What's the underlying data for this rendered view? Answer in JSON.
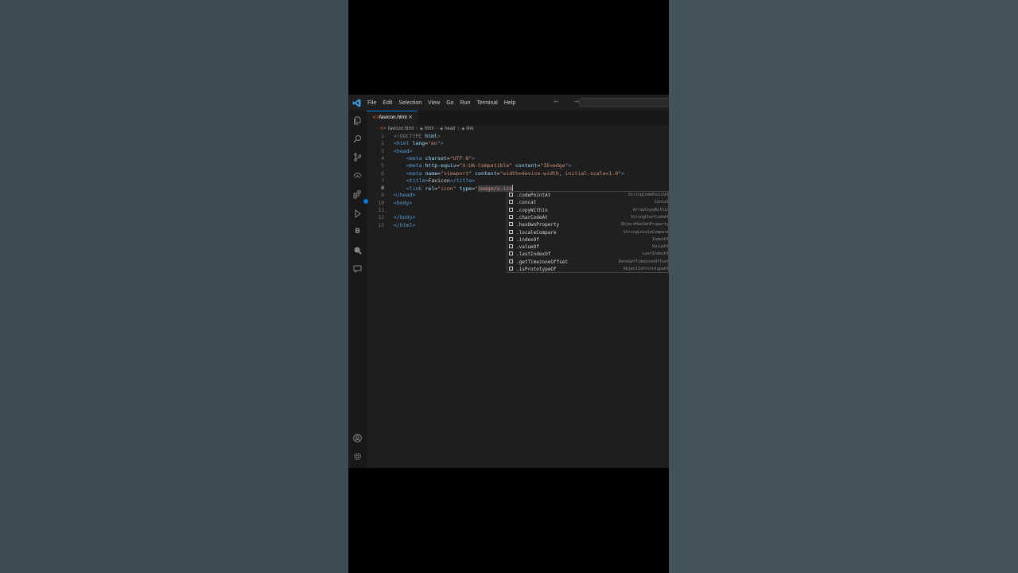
{
  "menu": [
    "File",
    "Edit",
    "Selection",
    "View",
    "Go",
    "Run",
    "Terminal",
    "Help"
  ],
  "nav_arrows": "← →",
  "activity_icons": [
    "explorer-icon",
    "search-icon",
    "source-control-icon",
    "remote-explorer-icon",
    "extensions-icon",
    "run-debug-icon",
    "bookmark-b-icon",
    "settings-sync-icon",
    "chat-icon",
    "account-icon",
    "manage-gear-icon"
  ],
  "tab": {
    "label": "favicon.html",
    "close": "×"
  },
  "breadcrumb": {
    "file": "favicon.html",
    "items": [
      "html",
      "head",
      "link"
    ]
  },
  "code_lines": [
    {
      "n": "1"
    },
    {
      "n": "2"
    },
    {
      "n": "3"
    },
    {
      "n": "4"
    },
    {
      "n": "5"
    },
    {
      "n": "6"
    },
    {
      "n": "7"
    },
    {
      "n": "8"
    },
    {
      "n": "9"
    },
    {
      "n": "10"
    },
    {
      "n": "11"
    },
    {
      "n": "12"
    },
    {
      "n": "13"
    }
  ],
  "code": {
    "l1_doctype": "<!DOCTYPE",
    "l1_html": " html",
    "l1_end": ">",
    "l2_open": "<html",
    "l2_attr": " lang",
    "l2_val": "\"en\"",
    "l3": "<head>",
    "l4_tag": "<meta",
    "l4_attr": " charset",
    "l4_val": "\"UTF-8\"",
    "l5_tag": "<meta",
    "l5_attr1": " http-equiv",
    "l5_val1": "\"X-UA-Compatible\"",
    "l5_attr2": " content",
    "l5_val2": "\"IE=edge\"",
    "l6_tag": "<meta",
    "l6_attr1": " name",
    "l6_val1": "\"viewport\"",
    "l6_attr2": " content",
    "l6_val2": "\"width=device-width, initial-scale=1.0\"",
    "l7_open": "<title>",
    "l7_text": "Favicon",
    "l7_close": "</title>",
    "l8_tag": "<link",
    "l8_attr1": " rel",
    "l8_val1": "\"icon\"",
    "l8_attr2": " type",
    "l8_quote": "\"",
    "l8_sel": "image/x-ico",
    "l9": "</head>",
    "l10": "<body>",
    "l12": "</body>",
    "l13": "</html>"
  },
  "suggestions": [
    {
      "label": ".codePointAt",
      "detail": "StringCodePointAt"
    },
    {
      "label": ".concat",
      "detail": "Concat"
    },
    {
      "label": ".copyWithin",
      "detail": "ArrayCopyWithin"
    },
    {
      "label": ".charCodeAt",
      "detail": "StringCharCodeAt"
    },
    {
      "label": ".hasOwnProperty",
      "detail": "ObjectHasOwnProperty"
    },
    {
      "label": ".localeCompare",
      "detail": "StringLocaleCompare"
    },
    {
      "label": ".indexOf",
      "detail": "IndexOf"
    },
    {
      "label": ".valueOf",
      "detail": "ValueOf"
    },
    {
      "label": ".lastIndexOf",
      "detail": "LastIndexOf"
    },
    {
      "label": ".getTimezoneOffset",
      "detail": "DateGetTimezoneOffset"
    },
    {
      "label": ".isPrototypeOf",
      "detail": "ObjectIsPrototypeOf"
    }
  ],
  "colors": {
    "accent": "#0078d4",
    "editor_bg": "#1e1e1e",
    "tag": "#569cd6",
    "attr": "#9cdcfe",
    "string": "#ce9178"
  }
}
